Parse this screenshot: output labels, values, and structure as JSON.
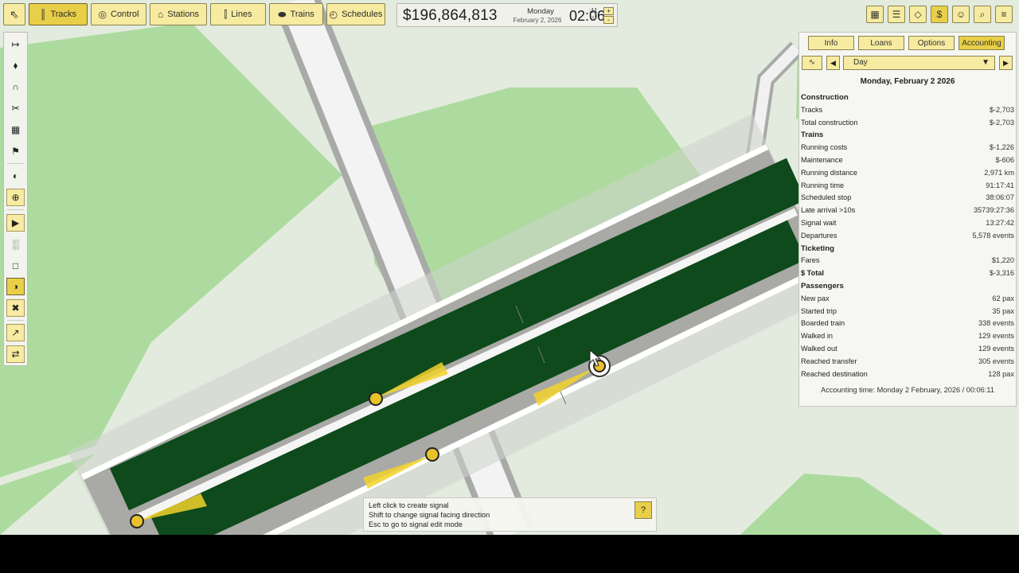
{
  "toolbar": {
    "items": [
      {
        "label": "Tracks",
        "icon": "tracks-icon",
        "active": true
      },
      {
        "label": "Control",
        "icon": "traffic-light-icon",
        "active": false
      },
      {
        "label": "Stations",
        "icon": "station-icon",
        "active": false
      },
      {
        "label": "Lines",
        "icon": "lines-icon",
        "active": false
      },
      {
        "label": "Trains",
        "icon": "train-icon",
        "active": false
      },
      {
        "label": "Schedules",
        "icon": "stopwatch-icon",
        "active": false
      }
    ]
  },
  "status": {
    "money": "$196,864,813",
    "day_of_week": "Monday",
    "date": "February 2, 2026",
    "time": "02:06",
    "seconds": ":11",
    "speed": "x2",
    "speed_up": "+",
    "speed_down": "-"
  },
  "right_tools": [
    {
      "icon": "map-icon"
    },
    {
      "icon": "layers-icon"
    },
    {
      "icon": "tag-icon"
    },
    {
      "icon": "dollar-icon"
    },
    {
      "icon": "people-icon"
    },
    {
      "icon": "search-icon"
    },
    {
      "icon": "menu-icon"
    }
  ],
  "accounting": {
    "tabs": [
      "Info",
      "Loans",
      "Options",
      "Accounting"
    ],
    "active_tab": "Accounting",
    "period": "Day",
    "date_heading": "Monday, February 2 2026",
    "rows": [
      {
        "label": "Construction",
        "value": "",
        "kind": "hdr"
      },
      {
        "label": "Tracks",
        "value": "$-2,703",
        "kind": ""
      },
      {
        "label": "Total construction",
        "value": "$-2,703",
        "kind": ""
      },
      {
        "label": "Trains",
        "value": "",
        "kind": "hdr"
      },
      {
        "label": "Running costs",
        "value": "$-1,226",
        "kind": ""
      },
      {
        "label": "Maintenance",
        "value": "$-606",
        "kind": ""
      },
      {
        "label": "Running distance",
        "value": "2,971 km",
        "kind": ""
      },
      {
        "label": "Running time",
        "value": "91:17:41",
        "kind": ""
      },
      {
        "label": "Scheduled stop",
        "value": "38:06:07",
        "kind": ""
      },
      {
        "label": "Late arrival >10s",
        "value": "35739:27:36",
        "kind": ""
      },
      {
        "label": "Signal wait",
        "value": "13:27:42",
        "kind": ""
      },
      {
        "label": "Departures",
        "value": "5,578 events",
        "kind": ""
      },
      {
        "label": "Ticketing",
        "value": "",
        "kind": "hdr"
      },
      {
        "label": "Fares",
        "value": "$1,220",
        "kind": ""
      },
      {
        "label": "$ Total",
        "value": "$-3,316",
        "kind": "tot"
      },
      {
        "label": "Passengers",
        "value": "",
        "kind": "hdr"
      },
      {
        "label": "New pax",
        "value": "62 pax",
        "kind": ""
      },
      {
        "label": "Started trip",
        "value": "35 pax",
        "kind": ""
      },
      {
        "label": "Boarded train",
        "value": "338 events",
        "kind": ""
      },
      {
        "label": "Walked in",
        "value": "129 events",
        "kind": ""
      },
      {
        "label": "Walked out",
        "value": "129 events",
        "kind": ""
      },
      {
        "label": "Reached transfer",
        "value": "305 events",
        "kind": ""
      },
      {
        "label": "Reached destination",
        "value": "128 pax",
        "kind": ""
      }
    ],
    "footer": "Accounting time: Monday 2 February, 2026 / 00:06:11"
  },
  "hint": {
    "lines": [
      "Left click to create signal",
      "Shift to change signal facing direction",
      "Esc to go to signal edit mode"
    ],
    "help_label": "?"
  },
  "colors": {
    "accent": "#e8cf47",
    "button": "#f6eba0",
    "track_green": "#0f4a1c",
    "grass": "#a9d79a",
    "ground": "#e3ebde"
  }
}
